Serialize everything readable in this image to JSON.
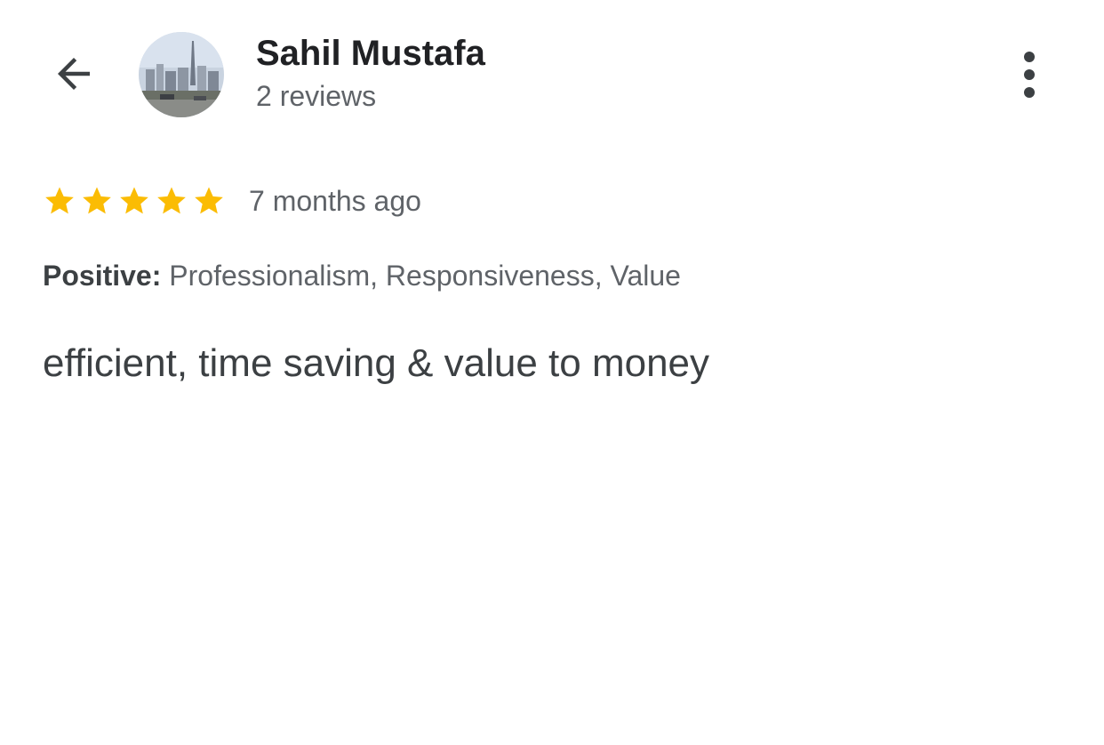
{
  "header": {
    "back_icon": "arrow-back-icon",
    "reviewer_name": "Sahil Mustafa",
    "review_count": "2 reviews",
    "more_icon": "more-vertical-icon"
  },
  "review": {
    "rating": 5,
    "rating_max": 5,
    "star_color": "#FBBC04",
    "time_ago": "7 months ago",
    "attributes_label": "Positive:",
    "attributes_value": " Professionalism, Responsiveness, Value",
    "text": "efficient, time saving & value to money"
  }
}
